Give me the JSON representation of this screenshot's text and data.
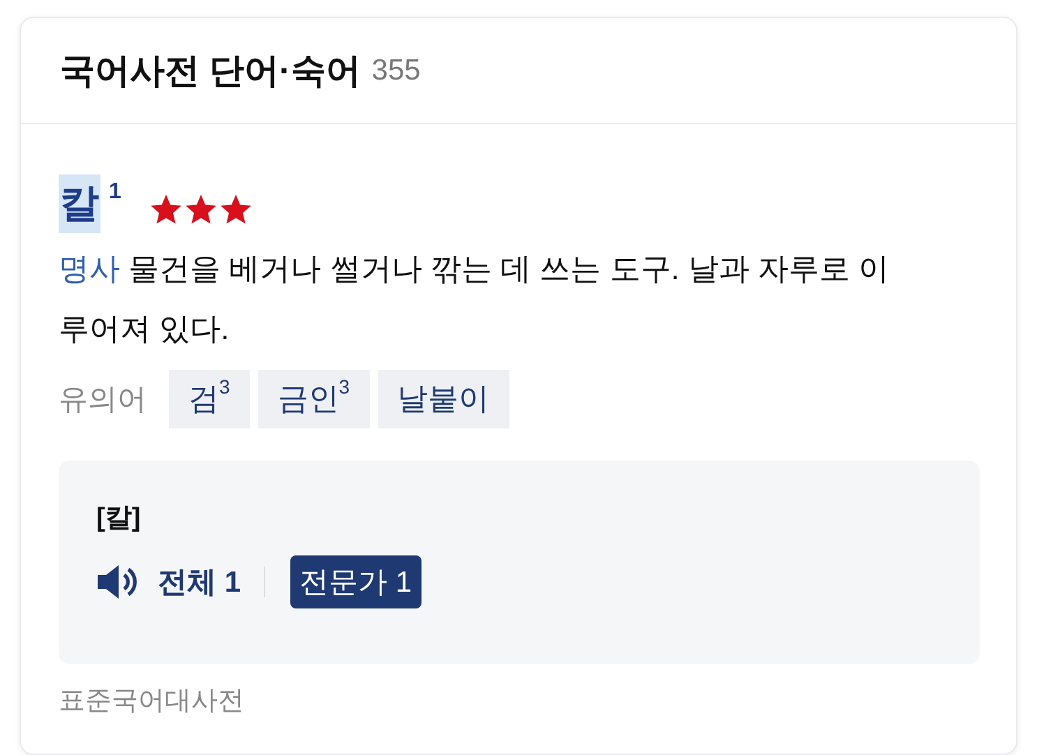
{
  "header": {
    "title": "국어사전 단어·숙어",
    "count": "355"
  },
  "entry": {
    "headword": "칼",
    "highlighted": true,
    "homonym": "1",
    "stars": 3,
    "pos": "명사",
    "definition": "물건을 베거나 썰거나 깎는 데 쓰는 도구. 날과 자루로 이루어져 있다.",
    "synonyms_label": "유의어",
    "synonyms": [
      "검$^{3}$",
      "금인$^{3}$",
      "날붙이"
    ],
    "pronunciation": {
      "text": "[칼]",
      "filters": [
        {
          "label": "전체 1",
          "selected": false
        },
        {
          "label": "전문가 1",
          "selected": true
        }
      ]
    },
    "source": "표준국어대사전"
  }
}
